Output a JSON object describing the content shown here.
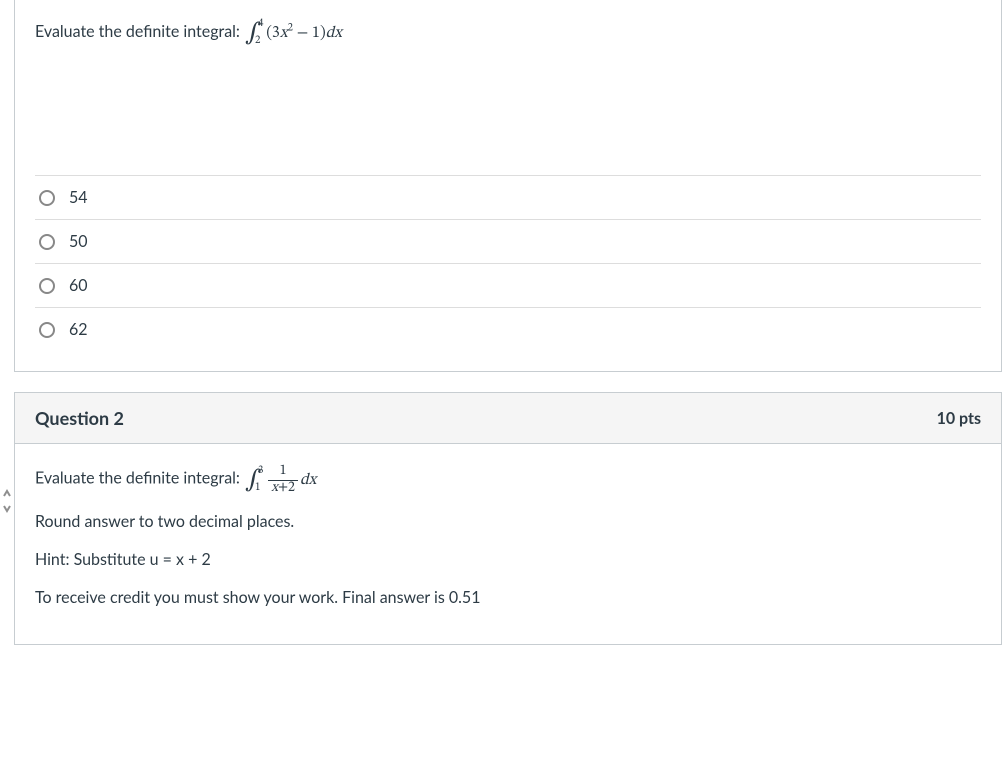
{
  "question1": {
    "prompt_prefix": "Evaluate the definite integral: ",
    "integral_lower": "2",
    "integral_upper": "4",
    "integrand_a": "(3",
    "integrand_var": "x",
    "integrand_exp": "2",
    "integrand_b": " − 1)",
    "integrand_dx": "dx",
    "options": [
      "54",
      "50",
      "60",
      "62"
    ]
  },
  "question2": {
    "title": "Question 2",
    "points": "10 pts",
    "prompt_prefix": "Evaluate the definite integral: ",
    "integral_lower": "1",
    "integral_upper": "3",
    "frac_num": "1",
    "frac_den_var": "x",
    "frac_den_rest": "+2",
    "integrand_dx": "dx",
    "line2": "Round answer to two decimal places.",
    "line3": "Hint: Substitute u = x + 2",
    "line4": "To receive credit you must show your work. Final answer is 0.51"
  }
}
